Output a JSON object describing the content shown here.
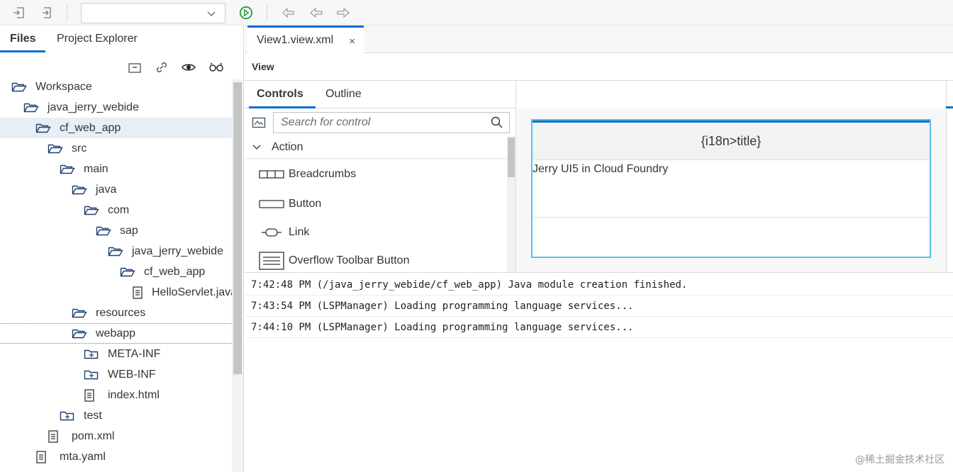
{
  "toolbar": {
    "run_config_value": "",
    "icons": [
      "import-icon",
      "export-icon",
      "run-icon",
      "deploy-icon",
      "back-icon",
      "forward-icon"
    ]
  },
  "left_pane": {
    "tabs": [
      {
        "label": "Files",
        "active": true
      },
      {
        "label": "Project Explorer",
        "active": false
      }
    ],
    "tree_tools": [
      "collapse-all-icon",
      "link-editor-icon",
      "show-hidden-icon",
      "search-files-icon"
    ],
    "tree": [
      {
        "label": "Workspace",
        "type": "folder-open",
        "level": 0
      },
      {
        "label": "java_jerry_webide",
        "type": "folder-open",
        "level": 1
      },
      {
        "label": "cf_web_app",
        "type": "folder-open",
        "level": 2,
        "selected": true
      },
      {
        "label": "src",
        "type": "folder-open",
        "level": 3
      },
      {
        "label": "main",
        "type": "folder-open",
        "level": 4
      },
      {
        "label": "java",
        "type": "folder-open",
        "level": 5
      },
      {
        "label": "com",
        "type": "folder-open",
        "level": 6
      },
      {
        "label": "sap",
        "type": "folder-open",
        "level": 7
      },
      {
        "label": "java_jerry_webide",
        "type": "folder-open",
        "level": 8
      },
      {
        "label": "cf_web_app",
        "type": "folder-open",
        "level": 9
      },
      {
        "label": "HelloServlet.java",
        "type": "file",
        "level": 10
      },
      {
        "label": "resources",
        "type": "folder-open",
        "level": 5
      },
      {
        "label": "webapp",
        "type": "folder-open",
        "level": 5,
        "focused": true
      },
      {
        "label": "META-INF",
        "type": "folder-closed",
        "level": 6
      },
      {
        "label": "WEB-INF",
        "type": "folder-closed",
        "level": 6
      },
      {
        "label": "index.html",
        "type": "file",
        "level": 6
      },
      {
        "label": "test",
        "type": "folder-closed",
        "level": 4
      },
      {
        "label": "pom.xml",
        "type": "file",
        "level": 3
      },
      {
        "label": "mta.yaml",
        "type": "file",
        "level": 2
      }
    ]
  },
  "editor": {
    "tab_label": "View1.view.xml",
    "tab_close": "×",
    "view_label": "View",
    "palette": {
      "tabs": [
        {
          "label": "Controls",
          "active": true
        },
        {
          "label": "Outline",
          "active": false
        }
      ],
      "search_placeholder": "Search for control",
      "group": "Action",
      "controls": [
        "Breadcrumbs",
        "Button",
        "Link",
        "Overflow Toolbar Button"
      ]
    },
    "preview": {
      "title": "{i18n>title}",
      "text": "Jerry UI5 in Cloud Foundry"
    }
  },
  "console": {
    "lines": [
      "7:42:48 PM (/java_jerry_webide/cf_web_app) Java module creation finished.",
      "7:43:54 PM (LSPManager) Loading programming language services...",
      "7:44:10 PM (LSPManager) Loading programming language services..."
    ]
  },
  "watermark": "@稀土掘金技术社区",
  "colors": {
    "accent": "#0a6ed1",
    "run_green": "#2b9a3a",
    "preview_border": "#5bc0eb"
  }
}
